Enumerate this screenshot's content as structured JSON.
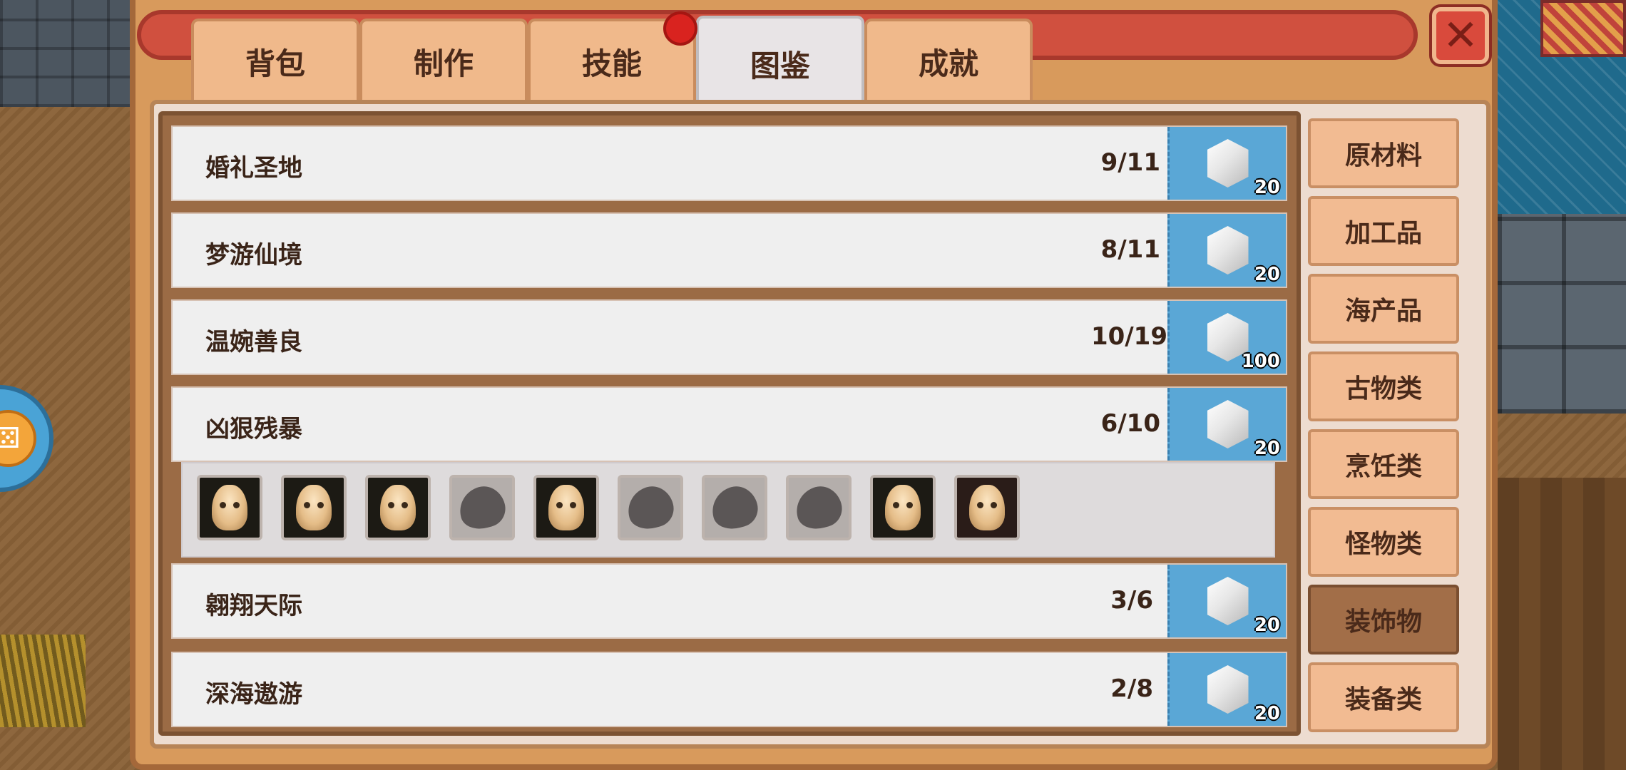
{
  "tabs": [
    {
      "label": "背包",
      "active": false
    },
    {
      "label": "制作",
      "active": false
    },
    {
      "label": "技能",
      "active": false
    },
    {
      "label": "图鉴",
      "active": true
    },
    {
      "label": "成就",
      "active": false
    }
  ],
  "close_label": "✕",
  "rows": [
    {
      "name": "婚礼圣地",
      "count": "9/11",
      "reward_qty": "20"
    },
    {
      "name": "梦游仙境",
      "count": "8/11",
      "reward_qty": "20"
    },
    {
      "name": "温婉善良",
      "count": "10/19",
      "reward_qty": "100"
    },
    {
      "name": "凶狠残暴",
      "count": "6/10",
      "reward_qty": "20",
      "expanded": true
    },
    {
      "name": "翱翔天际",
      "count": "3/6",
      "reward_qty": "20"
    },
    {
      "name": "深海遨游",
      "count": "2/8",
      "reward_qty": "20"
    }
  ],
  "expanded_items": [
    {
      "unlocked": true,
      "icon": "skull-icon"
    },
    {
      "unlocked": true,
      "icon": "skull-icon"
    },
    {
      "unlocked": true,
      "icon": "skull-icon"
    },
    {
      "unlocked": false,
      "icon": "locked-silhouette-icon"
    },
    {
      "unlocked": true,
      "icon": "skull-icon"
    },
    {
      "unlocked": false,
      "icon": "locked-silhouette-icon"
    },
    {
      "unlocked": false,
      "icon": "locked-silhouette-icon"
    },
    {
      "unlocked": false,
      "icon": "locked-silhouette-icon"
    },
    {
      "unlocked": true,
      "icon": "skull-icon"
    },
    {
      "unlocked": true,
      "icon": "skull-icon"
    }
  ],
  "categories": [
    {
      "label": "原材料",
      "active": false
    },
    {
      "label": "加工品",
      "active": false
    },
    {
      "label": "海产品",
      "active": false
    },
    {
      "label": "古物类",
      "active": false
    },
    {
      "label": "烹饪类",
      "active": false
    },
    {
      "label": "怪物类",
      "active": false
    },
    {
      "label": "装饰物",
      "active": true
    },
    {
      "label": "装备类",
      "active": false
    }
  ],
  "colors": {
    "accent_tab": "#f0b98b",
    "active_tab": "#e8e4e6",
    "reward_bg": "#5aa7d6",
    "category_active": "#a26e48",
    "close_btn": "#d94a3c"
  }
}
